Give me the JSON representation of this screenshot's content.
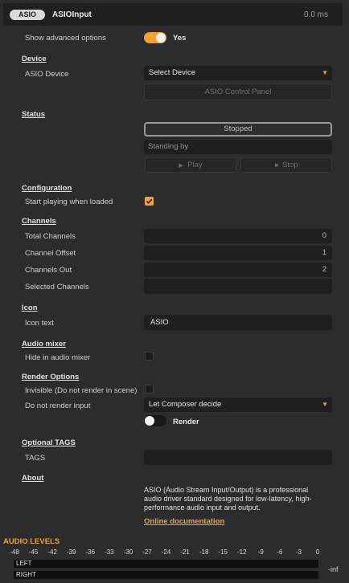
{
  "header": {
    "badge": "ASIO",
    "title": "ASIOInput",
    "time": "0.0 ms"
  },
  "advanced": {
    "label": "Show advanced options",
    "value": "Yes",
    "enabled": true
  },
  "device": {
    "section": "Device",
    "asio_label": "ASIO Device",
    "select_value": "Select Device",
    "control_panel": "ASIO Control Panel"
  },
  "status": {
    "section": "Status",
    "state": "Stopped",
    "message": "Standing by",
    "play": "Play",
    "stop": "Stop"
  },
  "configuration": {
    "section": "Configuration",
    "start_label": "Start playing when loaded",
    "start_checked": true
  },
  "channels": {
    "section": "Channels",
    "total_label": "Total Channels",
    "total_value": "0",
    "offset_label": "Channel Offset",
    "offset_value": "1",
    "out_label": "Channels Out",
    "out_value": "2",
    "selected_label": "Selected Channels",
    "selected_value": ""
  },
  "icon": {
    "section": "Icon",
    "text_label": "Icon text",
    "text_value": "ASIO"
  },
  "audio_mixer": {
    "section": "Audio mixer",
    "hide_label": "Hide in audio mixer",
    "hide_checked": false
  },
  "render": {
    "section": "Render Options",
    "invisible_label": "Invisible (Do not render in scene)",
    "invisible_checked": false,
    "no_render_label": "Do not render input",
    "no_render_value": "Let Composer decide",
    "render_toggle_label": "Render",
    "render_enabled": false
  },
  "tags": {
    "section": "Optional TAGS",
    "label": "TAGS",
    "value": ""
  },
  "about": {
    "section": "About",
    "line1": "ASIO (Audio Stream Input/Output) is a professional",
    "line2": "audio driver standard designed for low-latency, high-",
    "line3": "performance audio input and output.",
    "link": "Online documentation"
  },
  "levels": {
    "title": "AUDIO LEVELS",
    "ticks": [
      "-48",
      "-45",
      "-42",
      "-39",
      "-36",
      "-33",
      "-30",
      "-27",
      "-24",
      "-21",
      "-18",
      "-15",
      "-12",
      "-9",
      "-6",
      "-3",
      "0"
    ],
    "left": "LEFT",
    "right": "RIGHT",
    "readout": "-inf",
    "left_level": 0,
    "right_level": 0
  },
  "colors": {
    "accent": "#f3a12b",
    "background": "#2b2c2e",
    "field": "#1e1f21"
  },
  "icons": {
    "dropdown": "caret-down-icon",
    "play": "play-icon",
    "stop": "stop-icon"
  }
}
